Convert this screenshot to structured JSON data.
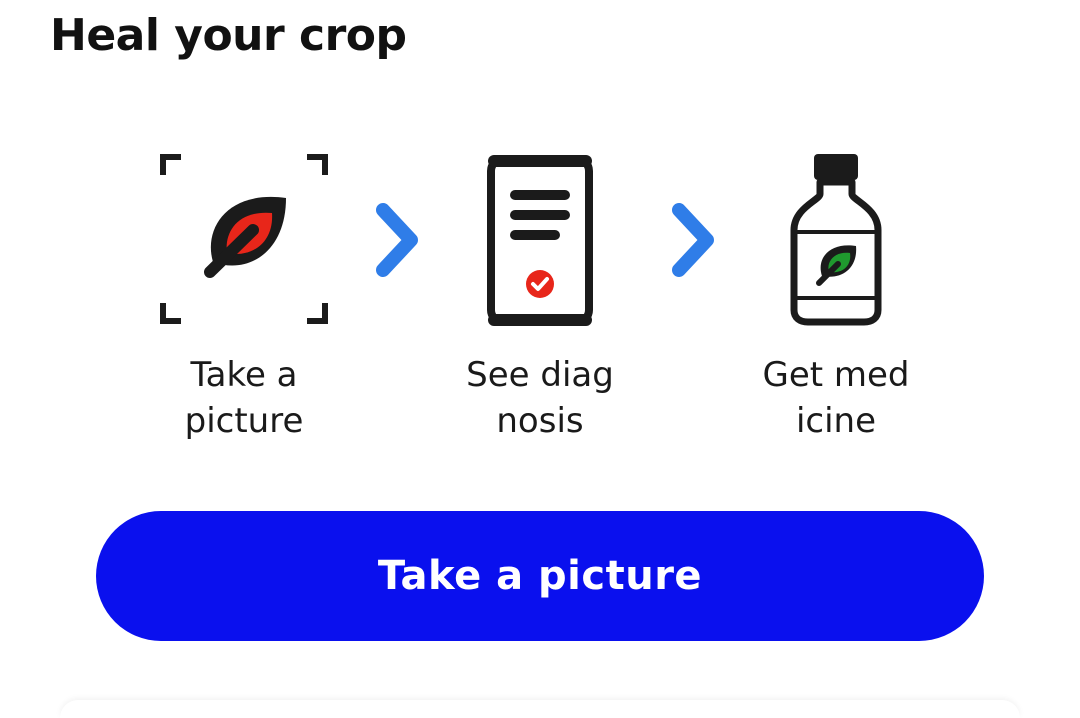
{
  "header": {
    "title": "Heal your crop"
  },
  "steps": [
    {
      "icon": "leaf-scan-icon",
      "line1": "Take a",
      "line2": "picture"
    },
    {
      "icon": "phone-diagnosis-icon",
      "line1": "See diag",
      "line2": "nosis"
    },
    {
      "icon": "medicine-bottle-icon",
      "line1": "Get med",
      "line2": "icine"
    }
  ],
  "separators": [
    {
      "icon": "chevron-right-icon"
    },
    {
      "icon": "chevron-right-icon"
    }
  ],
  "cta": {
    "label": "Take a picture"
  },
  "colors": {
    "accent_button": "#0a10ee",
    "chevron": "#2f7de8",
    "icon_stroke": "#1b1b1b",
    "leaf_red": "#e8261a",
    "leaf_green": "#1f9a2e",
    "check_red": "#e8261a"
  }
}
